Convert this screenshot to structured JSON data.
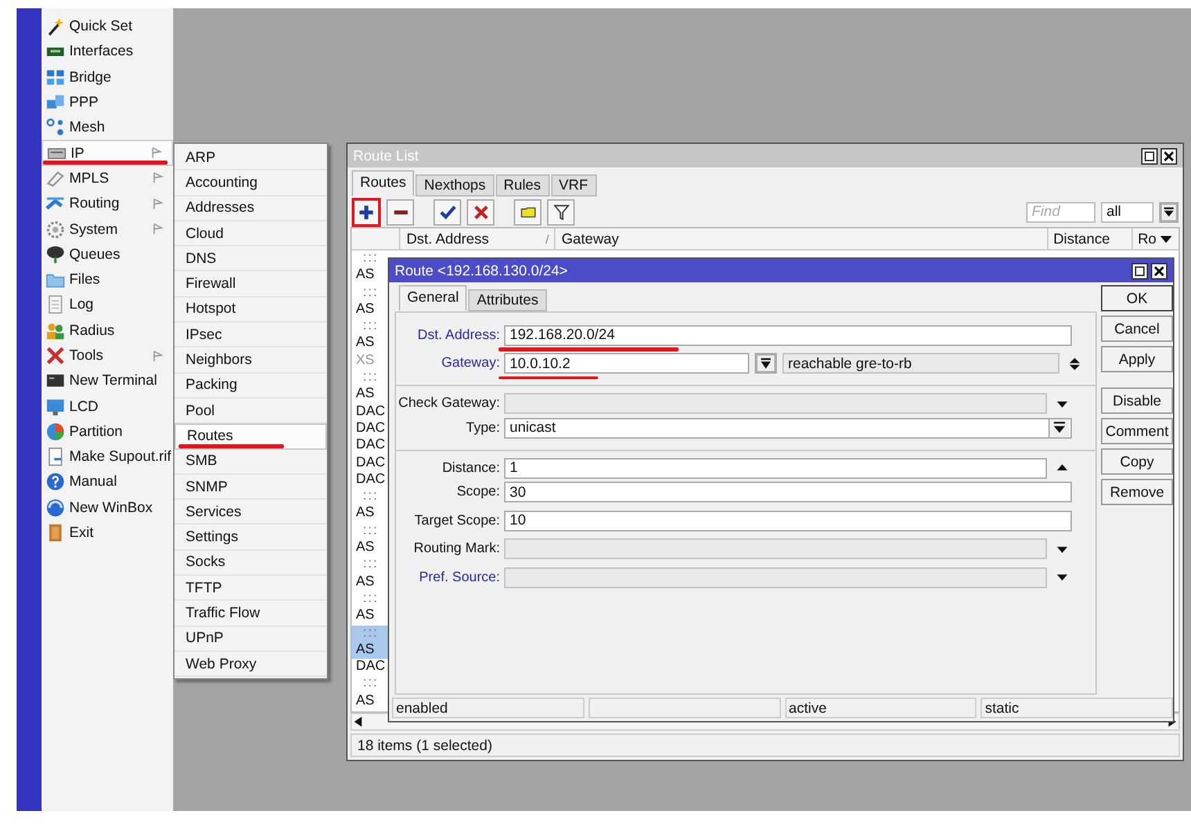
{
  "menu": {
    "items": [
      {
        "label": "Quick Set",
        "has_submenu": false,
        "selected": false,
        "marked": false
      },
      {
        "label": "Interfaces",
        "has_submenu": false,
        "selected": false,
        "marked": false
      },
      {
        "label": "Bridge",
        "has_submenu": false,
        "selected": false,
        "marked": false
      },
      {
        "label": "PPP",
        "has_submenu": false,
        "selected": false,
        "marked": false
      },
      {
        "label": "Mesh",
        "has_submenu": false,
        "selected": false,
        "marked": false
      },
      {
        "label": "IP",
        "has_submenu": true,
        "selected": true,
        "marked": true
      },
      {
        "label": "MPLS",
        "has_submenu": true,
        "selected": false,
        "marked": false
      },
      {
        "label": "Routing",
        "has_submenu": true,
        "selected": false,
        "marked": false
      },
      {
        "label": "System",
        "has_submenu": true,
        "selected": false,
        "marked": false
      },
      {
        "label": "Queues",
        "has_submenu": false,
        "selected": false,
        "marked": false
      },
      {
        "label": "Files",
        "has_submenu": false,
        "selected": false,
        "marked": false
      },
      {
        "label": "Log",
        "has_submenu": false,
        "selected": false,
        "marked": false
      },
      {
        "label": "Radius",
        "has_submenu": false,
        "selected": false,
        "marked": false
      },
      {
        "label": "Tools",
        "has_submenu": true,
        "selected": false,
        "marked": false
      },
      {
        "label": "New Terminal",
        "has_submenu": false,
        "selected": false,
        "marked": false
      },
      {
        "label": "LCD",
        "has_submenu": false,
        "selected": false,
        "marked": false
      },
      {
        "label": "Partition",
        "has_submenu": false,
        "selected": false,
        "marked": false
      },
      {
        "label": "Make Supout.rif",
        "has_submenu": false,
        "selected": false,
        "marked": false
      },
      {
        "label": "Manual",
        "has_submenu": false,
        "selected": false,
        "marked": false
      },
      {
        "label": "New WinBox",
        "has_submenu": false,
        "selected": false,
        "marked": false
      },
      {
        "label": "Exit",
        "has_submenu": false,
        "selected": false,
        "marked": false
      }
    ]
  },
  "submenu": {
    "items": [
      {
        "label": "ARP",
        "selected": false,
        "marked": false
      },
      {
        "label": "Accounting",
        "selected": false,
        "marked": false
      },
      {
        "label": "Addresses",
        "selected": false,
        "marked": false
      },
      {
        "label": "Cloud",
        "selected": false,
        "marked": false
      },
      {
        "label": "DNS",
        "selected": false,
        "marked": false
      },
      {
        "label": "Firewall",
        "selected": false,
        "marked": false
      },
      {
        "label": "Hotspot",
        "selected": false,
        "marked": false
      },
      {
        "label": "IPsec",
        "selected": false,
        "marked": false
      },
      {
        "label": "Neighbors",
        "selected": false,
        "marked": false
      },
      {
        "label": "Packing",
        "selected": false,
        "marked": false
      },
      {
        "label": "Pool",
        "selected": false,
        "marked": false
      },
      {
        "label": "Routes",
        "selected": true,
        "marked": true
      },
      {
        "label": "SMB",
        "selected": false,
        "marked": false
      },
      {
        "label": "SNMP",
        "selected": false,
        "marked": false
      },
      {
        "label": "Services",
        "selected": false,
        "marked": false
      },
      {
        "label": "Settings",
        "selected": false,
        "marked": false
      },
      {
        "label": "Socks",
        "selected": false,
        "marked": false
      },
      {
        "label": "TFTP",
        "selected": false,
        "marked": false
      },
      {
        "label": "Traffic Flow",
        "selected": false,
        "marked": false
      },
      {
        "label": "UPnP",
        "selected": false,
        "marked": false
      },
      {
        "label": "Web Proxy",
        "selected": false,
        "marked": false
      }
    ]
  },
  "route_list": {
    "title": "Route List",
    "tabs": [
      {
        "label": "Routes",
        "selected": true
      },
      {
        "label": "Nexthops",
        "selected": false
      },
      {
        "label": "Rules",
        "selected": false
      },
      {
        "label": "VRF",
        "selected": false
      }
    ],
    "toolbar": [
      {
        "kind": "add",
        "marked": true
      },
      {
        "kind": "remove",
        "marked": false
      },
      {
        "kind": "enable",
        "marked": false
      },
      {
        "kind": "disable",
        "marked": false
      },
      {
        "kind": "comment",
        "marked": false
      },
      {
        "kind": "filter",
        "marked": false
      }
    ],
    "search": {
      "placeholder": "Find"
    },
    "filter_select": {
      "value": "all"
    },
    "columns": [
      {
        "label": "Dst. Address",
        "sort_mark": "/"
      },
      {
        "label": "Gateway"
      },
      {
        "label": "Distance"
      },
      {
        "label": "Ro"
      }
    ],
    "rows": [
      {
        "kind": "comment",
        "text": ":::",
        "selected": false,
        "disabled": false
      },
      {
        "kind": "route",
        "text": "AS",
        "selected": false,
        "disabled": false
      },
      {
        "kind": "comment",
        "text": ":::",
        "selected": false,
        "disabled": false
      },
      {
        "kind": "route",
        "text": "AS",
        "selected": false,
        "disabled": false
      },
      {
        "kind": "comment",
        "text": ":::",
        "selected": false,
        "disabled": false
      },
      {
        "kind": "route",
        "text": "AS",
        "selected": false,
        "disabled": false
      },
      {
        "kind": "route",
        "text": "XS",
        "selected": false,
        "disabled": true
      },
      {
        "kind": "comment",
        "text": ":::",
        "selected": false,
        "disabled": false
      },
      {
        "kind": "route",
        "text": "AS",
        "selected": false,
        "disabled": false
      },
      {
        "kind": "route",
        "text": "DAC",
        "selected": false,
        "disabled": false
      },
      {
        "kind": "route",
        "text": "DAC",
        "selected": false,
        "disabled": false
      },
      {
        "kind": "route",
        "text": "DAC",
        "selected": false,
        "disabled": false
      },
      {
        "kind": "route",
        "text": "DAC",
        "selected": false,
        "disabled": false
      },
      {
        "kind": "route",
        "text": "DAC",
        "selected": false,
        "disabled": false
      },
      {
        "kind": "comment",
        "text": ":::",
        "selected": false,
        "disabled": false
      },
      {
        "kind": "route",
        "text": "AS",
        "selected": false,
        "disabled": false
      },
      {
        "kind": "comment",
        "text": ":::",
        "selected": false,
        "disabled": false
      },
      {
        "kind": "route",
        "text": "AS",
        "selected": false,
        "disabled": false
      },
      {
        "kind": "comment",
        "text": ":::",
        "selected": false,
        "disabled": false
      },
      {
        "kind": "route",
        "text": "AS",
        "selected": false,
        "disabled": false
      },
      {
        "kind": "comment",
        "text": ":::",
        "selected": false,
        "disabled": false
      },
      {
        "kind": "route",
        "text": "AS",
        "selected": false,
        "disabled": false
      },
      {
        "kind": "comment",
        "text": ":::",
        "selected": true,
        "disabled": false
      },
      {
        "kind": "route",
        "text": "AS",
        "selected": true,
        "disabled": false
      },
      {
        "kind": "route",
        "text": "DAC",
        "selected": false,
        "disabled": false
      },
      {
        "kind": "comment",
        "text": ":::",
        "selected": false,
        "disabled": false
      },
      {
        "kind": "route",
        "text": "AS",
        "selected": false,
        "disabled": false
      }
    ],
    "status": "18 items (1 selected)"
  },
  "route_dialog": {
    "title": "Route <192.168.130.0/24>",
    "tabs": [
      {
        "label": "General",
        "selected": true
      },
      {
        "label": "Attributes",
        "selected": false
      }
    ],
    "fields": [
      {
        "label": "Dst. Address:",
        "value": "192.168.20.0/24",
        "kind": "text",
        "highlighted": true,
        "marked": true,
        "disabled": false,
        "divider_before": false
      },
      {
        "label": "Gateway:",
        "value": "10.0.10.2",
        "status": "reachable gre-to-rb",
        "kind": "gateway",
        "highlighted": true,
        "marked": true,
        "disabled": false,
        "divider_before": false
      },
      {
        "label": "Check Gateway:",
        "kind": "select",
        "highlighted": false,
        "marked": false,
        "disabled": true,
        "divider_before": true
      },
      {
        "label": "Type:",
        "value": "unicast",
        "kind": "dropdown",
        "highlighted": false,
        "marked": false,
        "disabled": false,
        "divider_before": false
      },
      {
        "label": "Distance:",
        "value": "1",
        "kind": "spin",
        "highlighted": false,
        "marked": false,
        "disabled": false,
        "divider_before": true
      },
      {
        "label": "Scope:",
        "value": "30",
        "kind": "text",
        "highlighted": false,
        "marked": false,
        "disabled": false,
        "divider_before": false
      },
      {
        "label": "Target Scope:",
        "value": "10",
        "kind": "text",
        "highlighted": false,
        "marked": false,
        "disabled": false,
        "divider_before": false
      },
      {
        "label": "Routing Mark:",
        "kind": "select",
        "highlighted": false,
        "marked": false,
        "disabled": true,
        "divider_before": false
      },
      {
        "label": "Pref. Source:",
        "kind": "select",
        "highlighted": true,
        "marked": false,
        "disabled": true,
        "divider_before": false
      }
    ],
    "buttons": [
      {
        "label": "OK"
      },
      {
        "label": "Cancel"
      },
      {
        "label": "Apply"
      },
      {
        "label": "Disable"
      },
      {
        "label": "Comment"
      },
      {
        "label": "Copy"
      },
      {
        "label": "Remove"
      }
    ],
    "status_bar": {
      "column_1": "enabled",
      "column_3": "active",
      "column_4": "static"
    }
  }
}
